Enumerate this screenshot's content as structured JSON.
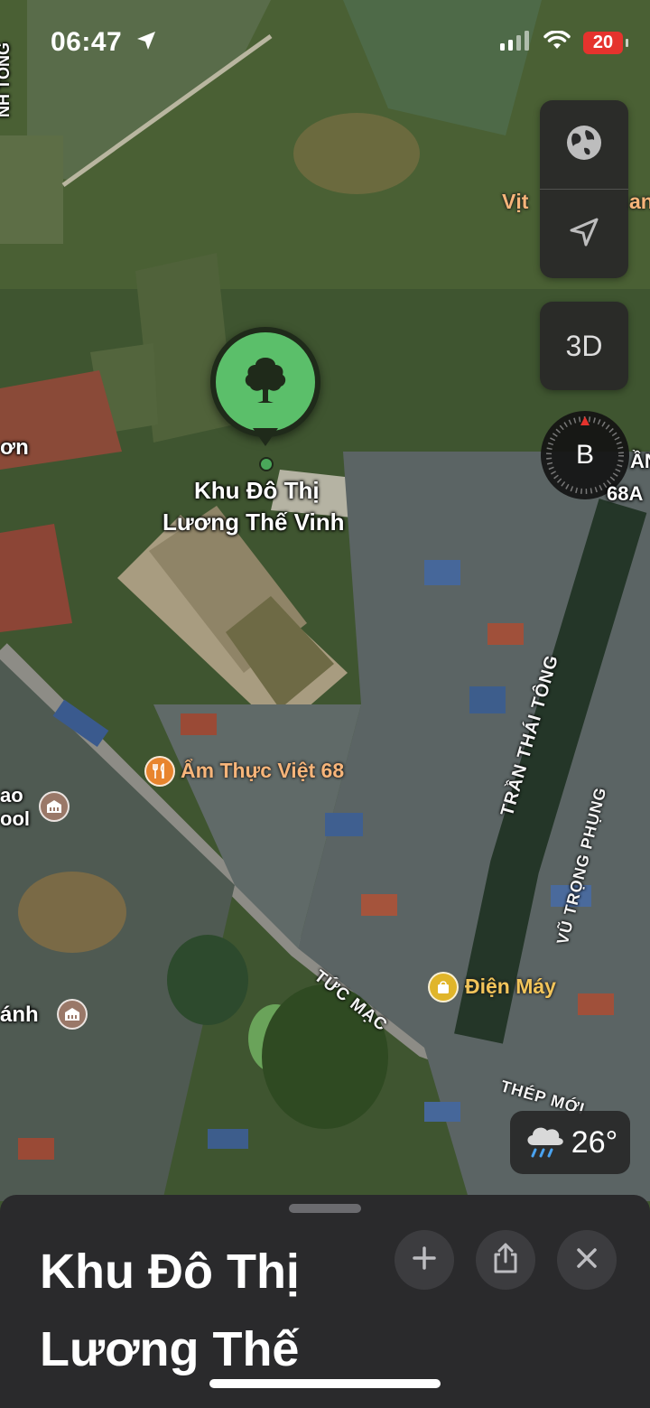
{
  "status_bar": {
    "time": "06:47",
    "battery": "20"
  },
  "map_controls": {
    "view_3d_label": "3D",
    "compass_letter": "B"
  },
  "place": {
    "pin_label_line1": "Khu Đô Thị",
    "pin_label_line2": "Lương Thế Vinh"
  },
  "pois": {
    "restaurant": "Ẩm Thực Việt 68",
    "shop": "Điện Máy",
    "school_partial": "ao\nool",
    "other_partial": "ánh"
  },
  "edge_labels": {
    "left_top": "NH TÔNG",
    "left_mid": "ơn",
    "right_top_a": "Vịt",
    "right_top_b": "an",
    "right_mid_a": "ẦN",
    "right_mid_b": "68A"
  },
  "streets": {
    "tran_thai_tong": "TRẦN THÁI TÔNG",
    "vu_trong_phung": "VŨ TRỌNG PHỤNG",
    "tuc_mac": "TỨC MẠC",
    "thep_moi": "THÉP MỚI"
  },
  "weather": {
    "temperature": "26°",
    "icon": "rain-cloud-icon"
  },
  "sheet": {
    "title": "Khu Đô Thị Lương Thế Vinh",
    "add_icon": "plus-icon",
    "share_icon": "share-icon",
    "close_icon": "close-icon"
  },
  "colors": {
    "pin_green": "#5bbf6a",
    "poi_orange": "#f7b57a",
    "restaurant_icon": "#e8852e",
    "shop_icon": "#e0b52a",
    "school_icon": "#9a7868",
    "battery_red": "#e5332d"
  }
}
